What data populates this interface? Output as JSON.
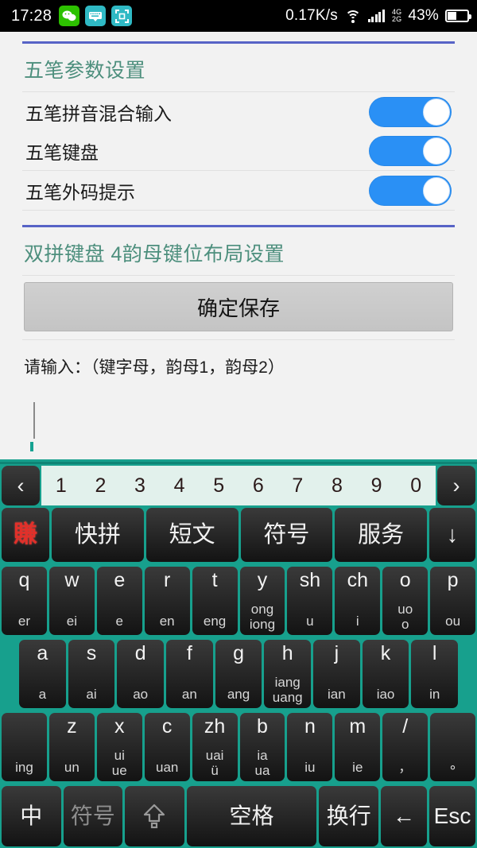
{
  "status_bar": {
    "time": "17:28",
    "apps": [
      {
        "name": "wechat-icon",
        "glyph": "●●"
      },
      {
        "name": "keyboard-icon",
        "glyph": "⌨"
      },
      {
        "name": "scan-icon",
        "glyph": "⧉"
      }
    ],
    "net_speed": "0.17K/s",
    "wifi": "wifi-icon",
    "signal_4g": "4G",
    "signal_2g": "2G",
    "battery_percent": "43%"
  },
  "settings": {
    "section1": {
      "title": "五笔参数设置",
      "rows": [
        {
          "label": "五笔拼音混合输入",
          "toggle": "on"
        },
        {
          "label": "五笔键盘",
          "toggle": "on"
        },
        {
          "label": "五笔外码提示",
          "toggle": "on"
        }
      ]
    },
    "section2": {
      "title": "双拼键盘 4韵母键位布局设置",
      "save_button": "确定保存",
      "hint": "请输入：（键字母，韵母1，韵母2）",
      "input_value": "",
      "input_placeholder": ""
    },
    "accent_blue": "#2a90f5",
    "header_green": "#4d8f7d",
    "rule_blue": "#5763c6"
  },
  "keyboard": {
    "bg_color": "#17a08d",
    "candidate_bar": {
      "prev": "‹",
      "next": "›",
      "numbers": [
        "1",
        "2",
        "3",
        "4",
        "5",
        "6",
        "7",
        "8",
        "9",
        "0"
      ]
    },
    "function_row": [
      {
        "name": "logo-key",
        "label": "賺"
      },
      {
        "name": "kuaipin-key",
        "label": "快拼"
      },
      {
        "name": "duanwen-key",
        "label": "短文"
      },
      {
        "name": "fuhao-key",
        "label": "符号"
      },
      {
        "name": "fuwu-key",
        "label": "服务"
      },
      {
        "name": "hide-keyboard-key",
        "label": "↓"
      }
    ],
    "row1": [
      {
        "main": "q",
        "sub": "er"
      },
      {
        "main": "w",
        "sub": "ei"
      },
      {
        "main": "e",
        "sub": "e"
      },
      {
        "main": "r",
        "sub": "en"
      },
      {
        "main": "t",
        "sub": "eng"
      },
      {
        "main": "y",
        "sub": "ong\niong"
      },
      {
        "main": "sh",
        "sub": "u"
      },
      {
        "main": "ch",
        "sub": "i"
      },
      {
        "main": "o",
        "sub": "uo\no"
      },
      {
        "main": "p",
        "sub": "ou"
      }
    ],
    "row2": [
      {
        "main": "a",
        "sub": "a"
      },
      {
        "main": "s",
        "sub": "ai"
      },
      {
        "main": "d",
        "sub": "ao"
      },
      {
        "main": "f",
        "sub": "an"
      },
      {
        "main": "g",
        "sub": "ang"
      },
      {
        "main": "h",
        "sub": "iang\nuang"
      },
      {
        "main": "j",
        "sub": "ian"
      },
      {
        "main": "k",
        "sub": "iao"
      },
      {
        "main": "l",
        "sub": "in"
      }
    ],
    "row3": [
      {
        "main": "",
        "sub": "ing"
      },
      {
        "main": "z",
        "sub": "un"
      },
      {
        "main": "x",
        "sub": "ui\nue"
      },
      {
        "main": "c",
        "sub": "uan"
      },
      {
        "main": "zh",
        "sub": "uai\nü"
      },
      {
        "main": "b",
        "sub": "ia\nua"
      },
      {
        "main": "n",
        "sub": "iu"
      },
      {
        "main": "m",
        "sub": "ie"
      },
      {
        "main": "/",
        "sub": "，"
      },
      {
        "main": "",
        "sub": "∘"
      }
    ],
    "bottom_row": [
      {
        "name": "lang-key",
        "label": "中",
        "dim": false
      },
      {
        "name": "symbol-key",
        "label": "符号",
        "dim": true
      },
      {
        "name": "shift-key",
        "label": "",
        "dim": false
      },
      {
        "name": "space-key",
        "label": "空格",
        "dim": false
      },
      {
        "name": "enter-key",
        "label": "换行",
        "dim": false
      },
      {
        "name": "backspace-key",
        "label": "←",
        "dim": false
      },
      {
        "name": "esc-key",
        "label": "Esc",
        "dim": false
      }
    ]
  }
}
